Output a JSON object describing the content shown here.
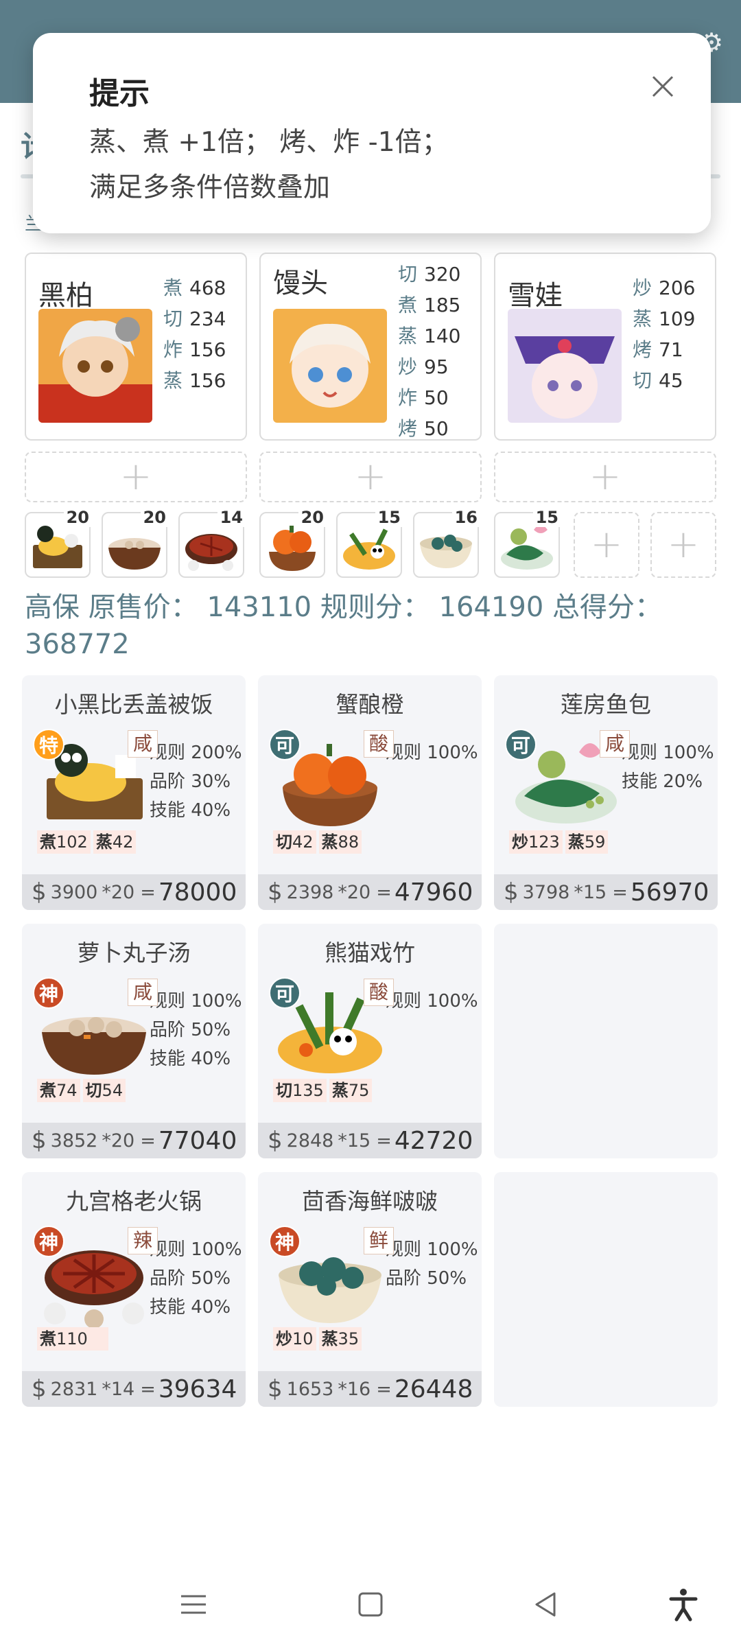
{
  "underlay": {
    "title_peek": "计",
    "sub_peek": "兰"
  },
  "toast": {
    "title": "提示",
    "line1": "蒸、煮 +1倍；  烤、炸 -1倍；",
    "line2": "满足多条件倍数叠加"
  },
  "chefs": [
    {
      "name": "黑柏",
      "stats": [
        {
          "skill": "煮",
          "value": "468"
        },
        {
          "skill": "切",
          "value": "234"
        },
        {
          "skill": "炸",
          "value": "156"
        },
        {
          "skill": "蒸",
          "value": "156"
        }
      ]
    },
    {
      "name": "馒头",
      "stats": [
        {
          "skill": "切",
          "value": "320"
        },
        {
          "skill": "煮",
          "value": "185"
        },
        {
          "skill": "蒸",
          "value": "140"
        },
        {
          "skill": "炒",
          "value": "95"
        },
        {
          "skill": "炸",
          "value": "50"
        },
        {
          "skill": "烤",
          "value": "50"
        }
      ]
    },
    {
      "name": "雪娃",
      "stats": [
        {
          "skill": "炒",
          "value": "206"
        },
        {
          "skill": "蒸",
          "value": "109"
        },
        {
          "skill": "烤",
          "value": "71"
        },
        {
          "skill": "切",
          "value": "45"
        }
      ]
    }
  ],
  "ingredients": [
    {
      "count": "20",
      "icon": "bento-icon"
    },
    {
      "count": "20",
      "icon": "meatball-pot-icon"
    },
    {
      "count": "14",
      "icon": "hotpot-icon"
    },
    {
      "count": "20",
      "icon": "crab-orange-icon"
    },
    {
      "count": "15",
      "icon": "bamboo-panda-icon"
    },
    {
      "count": "16",
      "icon": "seafood-bowl-icon"
    },
    {
      "count": "15",
      "icon": "lotus-fish-icon"
    }
  ],
  "summary": {
    "chef": "高保",
    "orig_label": "原售价：",
    "orig_value": "143110",
    "rule_label": "规则分：",
    "rule_value": "164190",
    "total_label": "总得分：",
    "total_value": "368772"
  },
  "dishes": [
    {
      "name": "小黑比丢盖被饭",
      "rarity": "特",
      "taste": "咸",
      "rules": [
        "规则 200%",
        "品阶 30%",
        "技能 40%"
      ],
      "req": [
        {
          "skill": "煮",
          "value": "102"
        },
        {
          "skill": "蒸",
          "value": "42"
        }
      ],
      "price": "3900",
      "mul": "*20",
      "total": "78000"
    },
    {
      "name": "蟹酿橙",
      "rarity": "可",
      "taste": "酸",
      "rules": [
        "规则 100%"
      ],
      "req": [
        {
          "skill": "切",
          "value": "42"
        },
        {
          "skill": "蒸",
          "value": "88"
        }
      ],
      "price": "2398",
      "mul": "*20",
      "total": "47960"
    },
    {
      "name": "莲房鱼包",
      "rarity": "可",
      "taste": "咸",
      "rules": [
        "规则 100%",
        "技能 20%"
      ],
      "req": [
        {
          "skill": "炒",
          "value": "123"
        },
        {
          "skill": "蒸",
          "value": "59"
        }
      ],
      "price": "3798",
      "mul": "*15",
      "total": "56970"
    },
    {
      "name": "萝卜丸子汤",
      "rarity": "神",
      "taste": "咸",
      "rules": [
        "规则 100%",
        "品阶 50%",
        "技能 40%"
      ],
      "req": [
        {
          "skill": "煮",
          "value": "74"
        },
        {
          "skill": "切",
          "value": "54"
        }
      ],
      "price": "3852",
      "mul": "*20",
      "total": "77040"
    },
    {
      "name": "熊猫戏竹",
      "rarity": "可",
      "taste": "酸",
      "rules": [
        "规则 100%"
      ],
      "req": [
        {
          "skill": "切",
          "value": "135"
        },
        {
          "skill": "蒸",
          "value": "75"
        }
      ],
      "price": "2848",
      "mul": "*15",
      "total": "42720"
    },
    {
      "name": "九宫格老火锅",
      "rarity": "神",
      "taste": "辣",
      "rules": [
        "规则 100%",
        "品阶 50%",
        "技能 40%"
      ],
      "req": [
        {
          "skill": "煮",
          "value": "110"
        }
      ],
      "price": "2831",
      "mul": "*14",
      "total": "39634"
    },
    {
      "name": "茴香海鲜啵啵",
      "rarity": "神",
      "taste": "鲜",
      "rules": [
        "规则 100%",
        "品阶 50%"
      ],
      "req": [
        {
          "skill": "炒",
          "value": "10"
        },
        {
          "skill": "蒸",
          "value": "35"
        }
      ],
      "price": "1653",
      "mul": "*16",
      "total": "26448"
    }
  ],
  "currency_symbol": "$",
  "equals": "=",
  "plus": "+",
  "colors": {
    "header": "#5b7d89",
    "card_bg": "#f4f5f8",
    "price_bar": "#dfe0e4"
  }
}
